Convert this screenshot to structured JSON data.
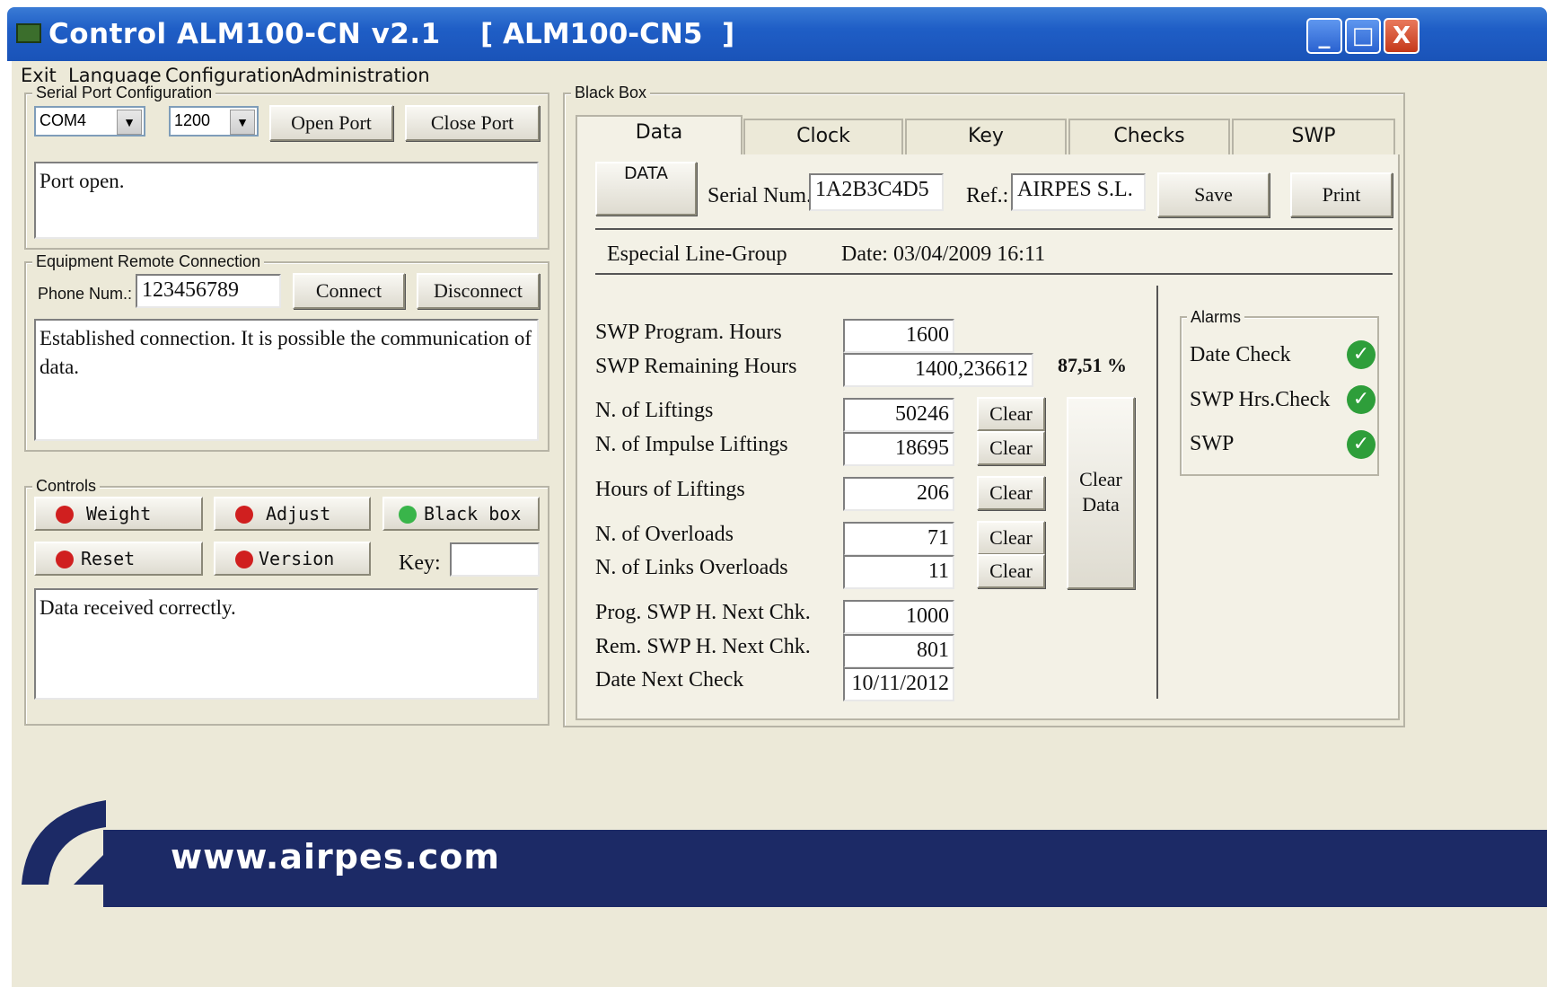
{
  "window": {
    "title": "Control ALM100-CN v2.1",
    "device": "[ ALM100-CN5  ]",
    "controls": {
      "minimize": "_",
      "maximize": "□",
      "close": "X"
    }
  },
  "menu": [
    "Exit",
    "Language",
    "Configuration",
    "Administration"
  ],
  "serial_port": {
    "group_label": "Serial Port Configuration",
    "port": "COM4",
    "baud": "1200",
    "open_label": "Open Port",
    "close_label": "Close Port",
    "status": "Port open."
  },
  "remote": {
    "group_label": "Equipment Remote Connection",
    "phone_label": "Phone Num.:",
    "phone_value": "123456789",
    "connect_label": "Connect",
    "disconnect_label": "Disconnect",
    "status": "Established connection. It is possible the communication of data."
  },
  "controls": {
    "group_label": "Controls",
    "weight": "Weight",
    "adjust": "Adjust",
    "black_box": "Black box",
    "reset": "Reset",
    "version": "Version",
    "key_label": "Key:",
    "key_value": "",
    "status": "Data received correctly.",
    "led_colors": {
      "red": "#d01f1f",
      "green": "#39b54a"
    }
  },
  "black_box": {
    "group_label": "Black Box",
    "tabs": [
      "Data",
      "Clock",
      "Key",
      "Checks",
      "SWP"
    ],
    "data_button": "DATA",
    "serial_label": "Serial Num.:",
    "serial_value": "1A2B3C4D5",
    "ref_label": "Ref.:",
    "ref_value": "AIRPES S.L.",
    "save_label": "Save",
    "print_label": "Print",
    "line_group": "Especial Line-Group",
    "date": "Date: 03/04/2009 16:11",
    "fields": {
      "swp_program_hours": {
        "label": "SWP Program. Hours",
        "value": "1600"
      },
      "swp_remaining_hours": {
        "label": "SWP Remaining Hours",
        "value": "1400,236612",
        "percent": "87,51 %"
      },
      "n_liftings": {
        "label": "N. of Liftings",
        "value": "50246"
      },
      "n_impulse_liftings": {
        "label": "N. of Impulse Liftings",
        "value": "18695"
      },
      "hours_liftings": {
        "label": "Hours of Liftings",
        "value": "206"
      },
      "n_overloads": {
        "label": "N. of Overloads",
        "value": "71"
      },
      "n_links_overloads": {
        "label": "N. of Links Overloads",
        "value": "11"
      },
      "prog_swp_next": {
        "label": "Prog. SWP H. Next Chk.",
        "value": "1000"
      },
      "rem_swp_next": {
        "label": "Rem. SWP H. Next Chk.",
        "value": "801"
      },
      "date_next_check": {
        "label": "Date Next Check",
        "value": "10/11/2012"
      }
    },
    "clear_label": "Clear",
    "clear_data_label": "Clear Data",
    "alarms": {
      "group_label": "Alarms",
      "items": [
        "Date Check",
        "SWP Hrs.Check",
        "SWP"
      ],
      "check_glyph": "✓"
    }
  },
  "footer": {
    "url": "www.airpes.com"
  }
}
